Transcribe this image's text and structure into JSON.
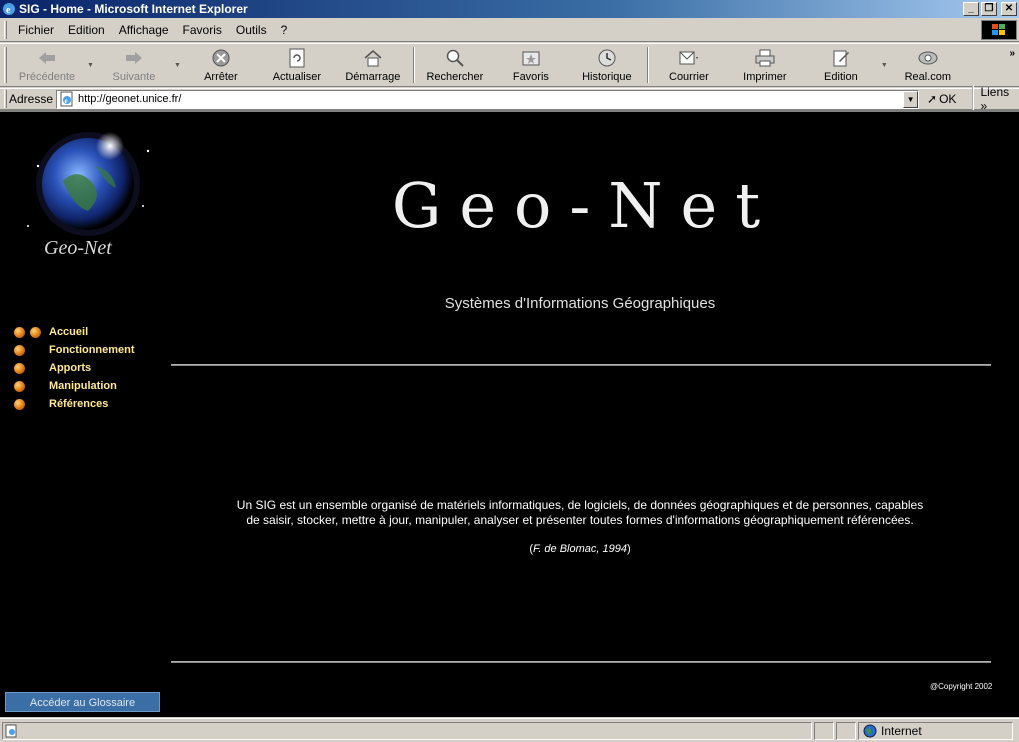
{
  "window": {
    "title": "SIG - Home - Microsoft Internet Explorer"
  },
  "menu": {
    "items": [
      "Fichier",
      "Edition",
      "Affichage",
      "Favoris",
      "Outils",
      "?"
    ]
  },
  "toolbar": {
    "buttons": [
      {
        "label": "Précédente",
        "icon": "back-arrow-icon",
        "enabled": false
      },
      {
        "label": "Suivante",
        "icon": "forward-arrow-icon",
        "enabled": false
      },
      {
        "label": "Arrêter",
        "icon": "stop-icon",
        "enabled": true
      },
      {
        "label": "Actualiser",
        "icon": "refresh-icon",
        "enabled": true
      },
      {
        "label": "Démarrage",
        "icon": "home-icon",
        "enabled": true
      },
      {
        "label": "Rechercher",
        "icon": "search-icon",
        "enabled": true
      },
      {
        "label": "Favoris",
        "icon": "favorites-icon",
        "enabled": true
      },
      {
        "label": "Historique",
        "icon": "history-icon",
        "enabled": true
      },
      {
        "label": "Courrier",
        "icon": "mail-icon",
        "enabled": true
      },
      {
        "label": "Imprimer",
        "icon": "print-icon",
        "enabled": true
      },
      {
        "label": "Edition",
        "icon": "edit-icon",
        "enabled": true
      },
      {
        "label": "Real.com",
        "icon": "real-icon",
        "enabled": true
      }
    ]
  },
  "address": {
    "label": "Adresse",
    "url": "http://geonet.unice.fr/",
    "go_label": "OK",
    "links_label": "Liens"
  },
  "page": {
    "logo_text": "Geo-Net",
    "banner_text": "Geo-Net",
    "subtitle": "Systèmes d'Informations Géographiques",
    "nav": [
      {
        "label": "Accueil",
        "bullets": 2
      },
      {
        "label": "Fonctionnement",
        "bullets": 1
      },
      {
        "label": "Apports",
        "bullets": 1
      },
      {
        "label": "Manipulation",
        "bullets": 1
      },
      {
        "label": "Références",
        "bullets": 1
      }
    ],
    "definition": "Un SIG est un ensemble organisé de matériels informatiques, de logiciels, de données géographiques et de personnes, capables de saisir, stocker, mettre à jour, manipuler, analyser et présenter toutes formes d'informations géographiquement référencées.",
    "citation_author": "F. de Blomac, 1994",
    "copyright": "@Copyright 2002",
    "glossary_button": "Accéder au Glossaire"
  },
  "status": {
    "zone": "Internet"
  },
  "colors": {
    "titlebar_start": "#0a246a",
    "nav_link": "#ffe88a",
    "glossary_button": "#3a6ea5",
    "content_bg": "#000000"
  }
}
